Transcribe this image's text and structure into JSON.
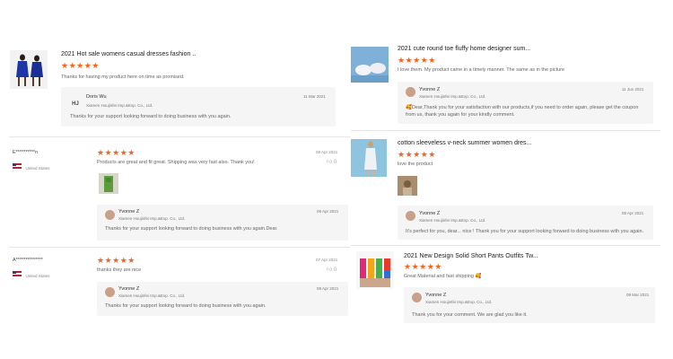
{
  "left_column": {
    "item1": {
      "title": "2021 Hot sale womens casual dresses fashion ..",
      "stars": "★★★★★",
      "text": "Thanks for having my product here on time as promised.",
      "reply": {
        "initials": "HJ",
        "name": "Doris Wu",
        "company": "Xiamen Houjinfei Imp.&Exp. Co., Ltd.",
        "date": "11 Mar 2021",
        "text": "Thanks for your support looking forward to doing business with you again."
      }
    },
    "review1": {
      "user": "E**********n",
      "country": "United States",
      "stars": "★★★★★",
      "date": "08 Apr 2021",
      "likes": "0",
      "text": "Products are great and fit great. Shipping was very fast also. Thank you!",
      "reply": {
        "name": "Yvonne Z",
        "company": "Xiamen Houjinfei Imp.&Exp. Co., Ltd.",
        "date": "08 Apr 2021",
        "text": "Thanks for your support looking forward to doing business with you again.Dear."
      }
    },
    "review2": {
      "user": "A**************",
      "country": "United States",
      "stars": "★★★★★",
      "date": "07 Apr 2021",
      "likes": "0",
      "text": "thanks they are nice",
      "reply": {
        "name": "Yvonne Z",
        "company": "Xiamen Houjinfei Imp.&Exp. Co., Ltd.",
        "date": "08 Apr 2021",
        "text": "Thanks for your support looking forward to doing business with you again."
      }
    }
  },
  "right_column": {
    "item1": {
      "title": "2021 cute round toe fluffy home designer sum...",
      "stars": "★★★★★",
      "text": "I love them. My product came in a timely manner. The same as in the picture",
      "reply": {
        "name": "Yvonne Z",
        "company": "Xiamen Houjinfei Imp.&Exp. Co., Ltd.",
        "date": "11 Jun 2021",
        "text1": "🥰Dear,Thank you for your satisfaction with our products,if you need to order again, please get the coupon",
        "text2": "from us, thank you again for your kindly comment."
      }
    },
    "item2": {
      "title": "cotton sleeveless v-neck summer women dres...",
      "stars": "★★★★★",
      "text": "love the product",
      "reply": {
        "name": "Yvonne Z",
        "company": "Xiamen Houjinfei Imp.&Exp. Co., Ltd.",
        "date": "08 Apr 2021",
        "text": "It's perfect for you, dear... nice ! Thank you for your support looking forward to doing business with you again."
      }
    },
    "item3": {
      "title": "2021 New Design Solid Short Pants Outfits Tw...",
      "stars": "★★★★★",
      "text": "Great Material and fast shipping 🥰",
      "reply": {
        "name": "Yvonne Z",
        "company": "Xiamen Houjinfei Imp.&Exp. Co., Ltd.",
        "date": "09 Mar 2021",
        "text": "Thank you for your comment. We are glad you like it."
      }
    }
  },
  "colors": {
    "star": "#f5641e",
    "reply_bg": "#f5f5f5"
  },
  "icons": [
    "thumbs-up-icon",
    "us-flag-icon",
    "user-avatar-icon"
  ]
}
